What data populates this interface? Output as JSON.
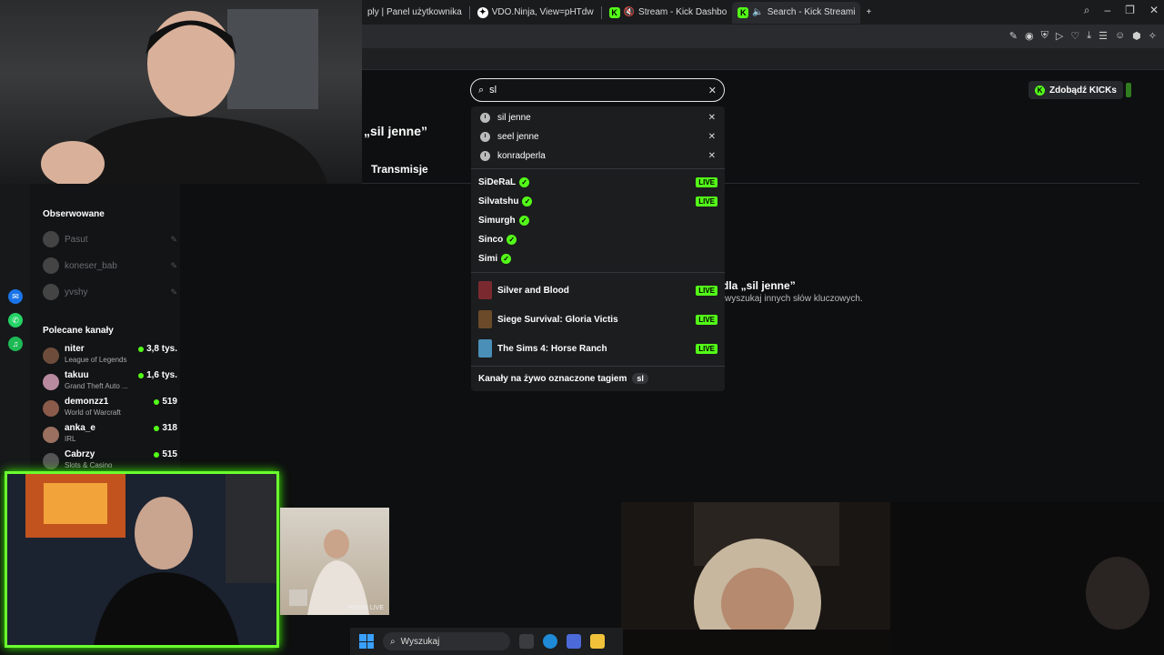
{
  "browser": {
    "tabs": [
      {
        "label": "ply | Panel użytkownika",
        "active": false
      },
      {
        "label": "VDO.Ninja, View=pHTdw",
        "active": false
      },
      {
        "label": "Stream - Kick Dashbo",
        "active": false
      },
      {
        "label": "Search - Kick Streami",
        "active": true
      }
    ],
    "new_tab_glyph": "+"
  },
  "search": {
    "query": "sl",
    "history": [
      "sil jenne",
      "seel jenne",
      "konradperla"
    ],
    "channels": [
      {
        "name": "SiDeRaL",
        "live": true
      },
      {
        "name": "Silvatshu",
        "live": true
      },
      {
        "name": "Simurgh",
        "live": false
      },
      {
        "name": "Sinco",
        "live": false
      },
      {
        "name": "Simi",
        "live": false
      }
    ],
    "categories": [
      {
        "name": "Silver and Blood",
        "live": true,
        "color": "#7a2a2f"
      },
      {
        "name": "Siege Survival: Gloria Victis",
        "live": true,
        "color": "#6b4a2a"
      },
      {
        "name": "The Sims 4: Horse Ranch",
        "live": true,
        "color": "#4a8fb8"
      }
    ],
    "live_label": "LIVE",
    "tag_row_label": "Kanały na żywo oznaczone tagiem",
    "tag_value": "sl"
  },
  "page": {
    "title": "„sil jenne”",
    "tab_streams": "Transmisje",
    "no_results_title": "dla „sil jenne”",
    "no_results_sub": "wyszukaj innych słów kluczowych.",
    "kicks_button": "Zdobądź KICKs"
  },
  "sidebar": {
    "followed_heading": "Obserwowane",
    "followed": [
      "Pasut",
      "koneser_bab",
      "yvshy"
    ],
    "recommended_heading": "Polecane kanały",
    "recommended": [
      {
        "name": "niter",
        "game": "League of Legends",
        "viewers": "3,8 tys.",
        "avatar": "#6d4c3b"
      },
      {
        "name": "takuu",
        "game": "Grand Theft Auto ...",
        "viewers": "1,6 tys.",
        "avatar": "#b88aa0"
      },
      {
        "name": "demonzz1",
        "game": "World of Warcraft",
        "viewers": "519",
        "avatar": "#8a5a4a"
      },
      {
        "name": "anka_e",
        "game": "IRL",
        "viewers": "318",
        "avatar": "#9a7060"
      },
      {
        "name": "Cabrzy",
        "game": "Slots & Casino",
        "viewers": "515",
        "avatar": "#555"
      }
    ]
  },
  "overlay": {
    "prism_label": "PRISM LIVE"
  },
  "taskbar": {
    "search_label": "Wyszukaj"
  },
  "colors": {
    "accent": "#53fc18",
    "cam_border": "#6bff2e"
  }
}
